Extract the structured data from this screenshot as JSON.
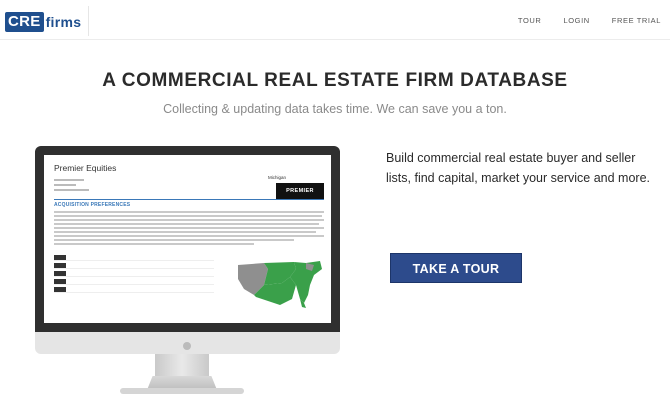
{
  "logo": {
    "box_text": "CRE",
    "rest_text": "firms"
  },
  "nav": {
    "links": [
      "TOUR",
      "LOGIN",
      "FREE TRIAL"
    ]
  },
  "hero": {
    "title": "A COMMERCIAL REAL ESTATE FIRM DATABASE",
    "subtitle": "Collecting & updating data takes time. We can save you a ton."
  },
  "screen": {
    "firm_name": "Premier Equities",
    "section_heading": "ACQUISITION PREFERENCES",
    "location": "Michigan",
    "logo_text": "PREMIER"
  },
  "pitch": {
    "text": "Build commercial real estate buyer and seller lists, find capital, market your service and more."
  },
  "cta": {
    "label": "TAKE A TOUR"
  },
  "colors": {
    "brand": "#1f4f8e",
    "button": "#2d4b8c",
    "map_green": "#3aa04a",
    "map_gray": "#8f8f8f"
  }
}
